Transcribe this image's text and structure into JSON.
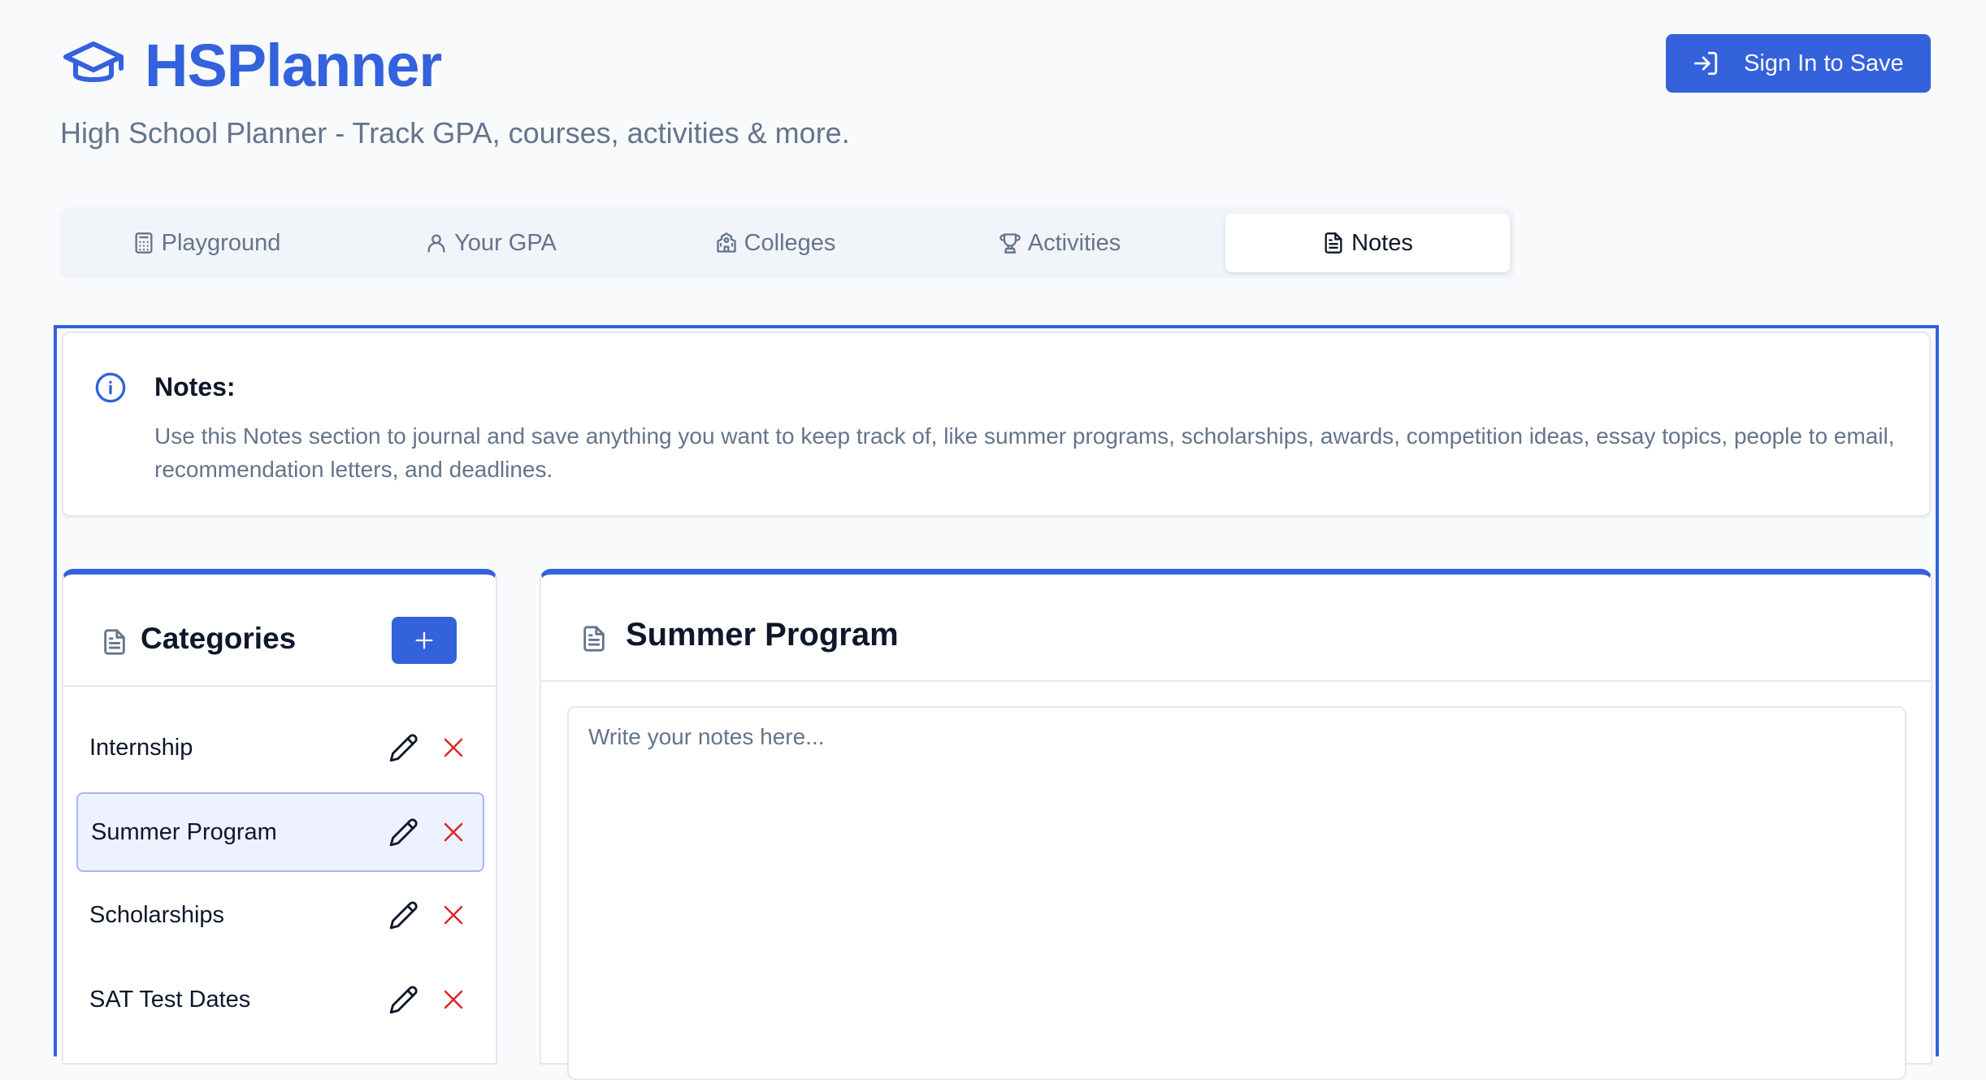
{
  "header": {
    "brand": "HSPlanner",
    "tagline": "High School Planner - Track GPA, courses, activities & more.",
    "signin_label": "Sign In to Save"
  },
  "tabs": [
    {
      "label": "Playground",
      "icon": "calculator-icon",
      "active": false
    },
    {
      "label": "Your GPA",
      "icon": "user-icon",
      "active": false
    },
    {
      "label": "Colleges",
      "icon": "school-icon",
      "active": false
    },
    {
      "label": "Activities",
      "icon": "trophy-icon",
      "active": false
    },
    {
      "label": "Notes",
      "icon": "document-icon",
      "active": true
    }
  ],
  "info": {
    "title": "Notes:",
    "body": "Use this Notes section to journal and save anything you want to keep track of, like summer programs, scholarships, awards, competition ideas, essay topics, people to email, recommendation letters, and deadlines."
  },
  "categories": {
    "title": "Categories",
    "items": [
      {
        "label": "Internship",
        "selected": false
      },
      {
        "label": "Summer Program",
        "selected": true
      },
      {
        "label": "Scholarships",
        "selected": false
      },
      {
        "label": "SAT Test Dates",
        "selected": false
      }
    ]
  },
  "editor": {
    "title": "Summer Program",
    "placeholder": "Write your notes here...",
    "value": ""
  },
  "colors": {
    "accent": "#3461dc",
    "delete": "#dc2626",
    "muted_text": "#64748b"
  }
}
